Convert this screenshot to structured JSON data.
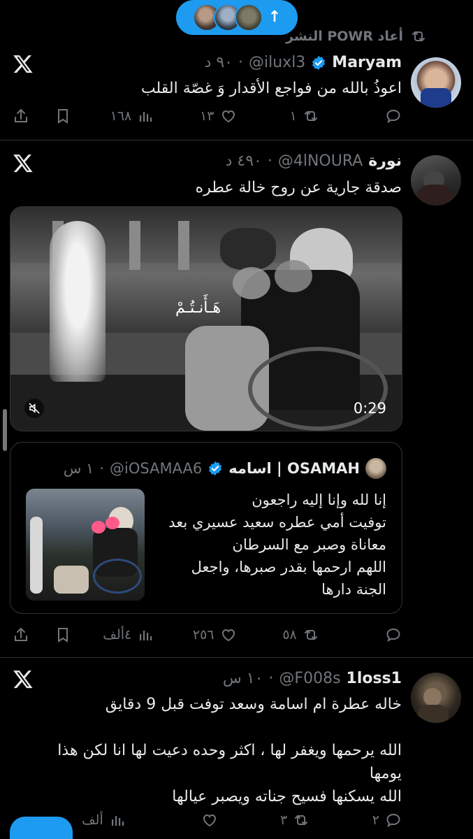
{
  "banner": {
    "new_posts_arrow": "↑"
  },
  "repost_label": "أعاد POWR النشر",
  "posts": [
    {
      "name": "Maryam",
      "handle": "@iluxl3",
      "time": "٩٠ د",
      "separator": "·",
      "text": "اعوذُ بالله من فواجع الأقدار وَ غصّة القلب",
      "stats": {
        "replies": "",
        "reposts": "١",
        "likes": "١٣",
        "views": "١٦٨"
      }
    },
    {
      "name": "نورة",
      "handle": "@4lNOURA",
      "time": "٤٩٠ د",
      "separator": "·",
      "text": "صدقة جارية عن روح خالة عطره",
      "video": {
        "duration": "0:29",
        "overlay_text": "هَـأَنـتُـمْ"
      },
      "quote": {
        "name": "OSAMAH | اسامه",
        "handle": "@iOSAMAA6",
        "time": "١ س",
        "separator": "·",
        "lines": [
          "إنا لله وإنا إليه راجعون",
          "توفيت أمي عطره سعيد عسيري بعد",
          "معاناة وصبر مع السرطان",
          "اللهم ارحمها بقدر صبرها، واجعل",
          "الجنة دارها"
        ]
      },
      "stats": {
        "replies": "",
        "reposts": "٥٨",
        "likes": "٢٥٦",
        "views": "٤ألف"
      }
    },
    {
      "name": "1loss1",
      "handle": "@F008s",
      "time": "١٠ س",
      "separator": "·",
      "lines": [
        "خاله عطرة ام اسامة وسعد توفت قبل 9 دقايق",
        "",
        "الله يرحمها ويغفر لها ، اكثر وحده دعيت لها انا لكن هذا",
        "يومها",
        "الله يسكنها فسيح جناته ويصبر عيالها"
      ],
      "stats": {
        "replies": "٢",
        "reposts": "٣",
        "likes": "",
        "views": "ألف"
      }
    }
  ],
  "colors": {
    "accent": "#1d9bf0",
    "muted": "#71767b",
    "text": "#e7e9ea",
    "divider": "#2f3336"
  }
}
